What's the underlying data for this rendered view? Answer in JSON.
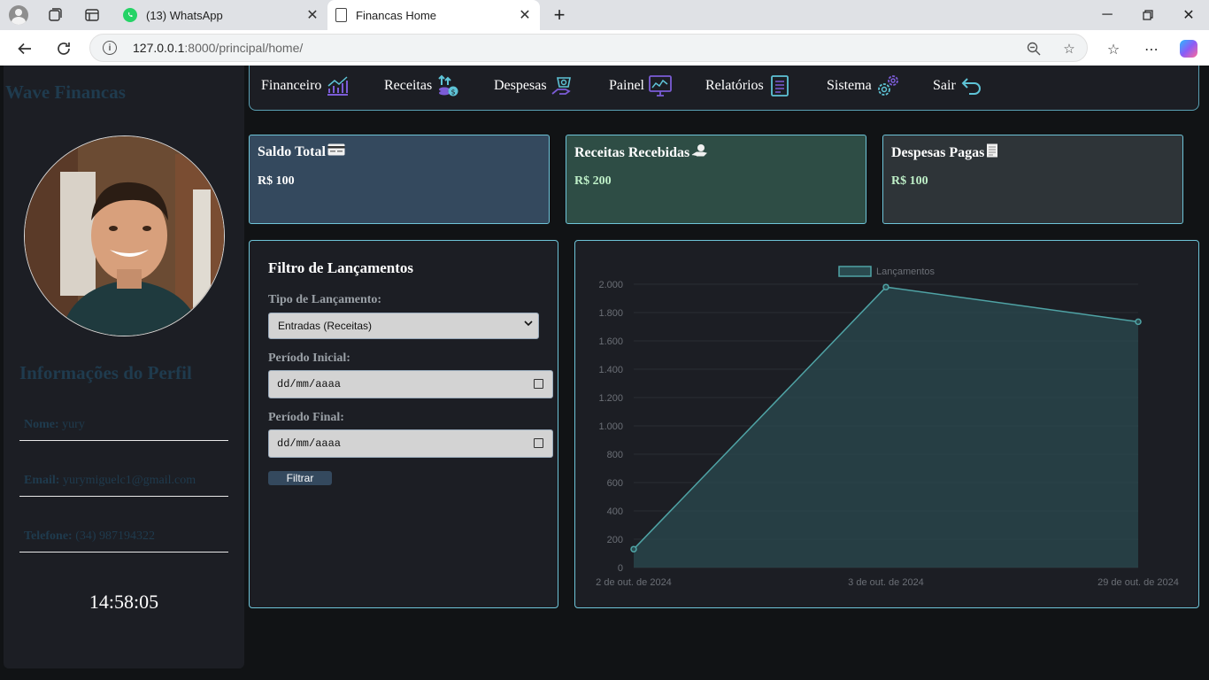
{
  "browser": {
    "tabs": [
      {
        "title": "(13) WhatsApp"
      },
      {
        "title": "Financas Home"
      }
    ],
    "url_host": "127.0.0.1",
    "url_path": ":8000/principal/home/"
  },
  "sidebar": {
    "brand": "Wave Financas",
    "info_title": "Informações do Perfil",
    "name_label": "Nome:",
    "name_value": "yury",
    "email_label": "Email:",
    "email_value": "yurymiguelc1@gmail.com",
    "phone_label": "Telefone:",
    "phone_value": "(34) 987194322",
    "clock": "14:58:05"
  },
  "nav": {
    "items": [
      "Financeiro",
      "Receitas",
      "Despesas",
      "Painel",
      "Relatórios",
      "Sistema",
      "Sair"
    ]
  },
  "cards": {
    "saldo_title": "Saldo Total",
    "saldo_value": "R$ 100",
    "receitas_title": "Receitas Recebidas",
    "receitas_value": "R$ 200",
    "despesas_title": "Despesas Pagas",
    "despesas_value": "R$ 100"
  },
  "filter": {
    "title": "Filtro de Lançamentos",
    "type_label": "Tipo de Lançamento:",
    "type_value": "Entradas (Receitas)",
    "start_label": "Período Inicial:",
    "start_placeholder": "dd/mm/aaaa",
    "end_label": "Período Final:",
    "end_placeholder": "dd/mm/aaaa",
    "button": "Filtrar"
  },
  "chart_data": {
    "type": "area",
    "series": [
      {
        "name": "Lançamentos",
        "values": [
          130,
          1980,
          1735
        ]
      }
    ],
    "x": [
      "2 de out. de 2024",
      "3 de out. de 2024",
      "29 de out. de 2024"
    ],
    "y_ticks": [
      "0",
      "200",
      "400",
      "600",
      "800",
      "1.000",
      "1.200",
      "1.400",
      "1.600",
      "1.800",
      "2.000"
    ],
    "ylim": [
      0,
      2000
    ],
    "legend": "top-center",
    "colors": {
      "line": "#4fa3a5",
      "fill": "#2a4a4f"
    }
  }
}
